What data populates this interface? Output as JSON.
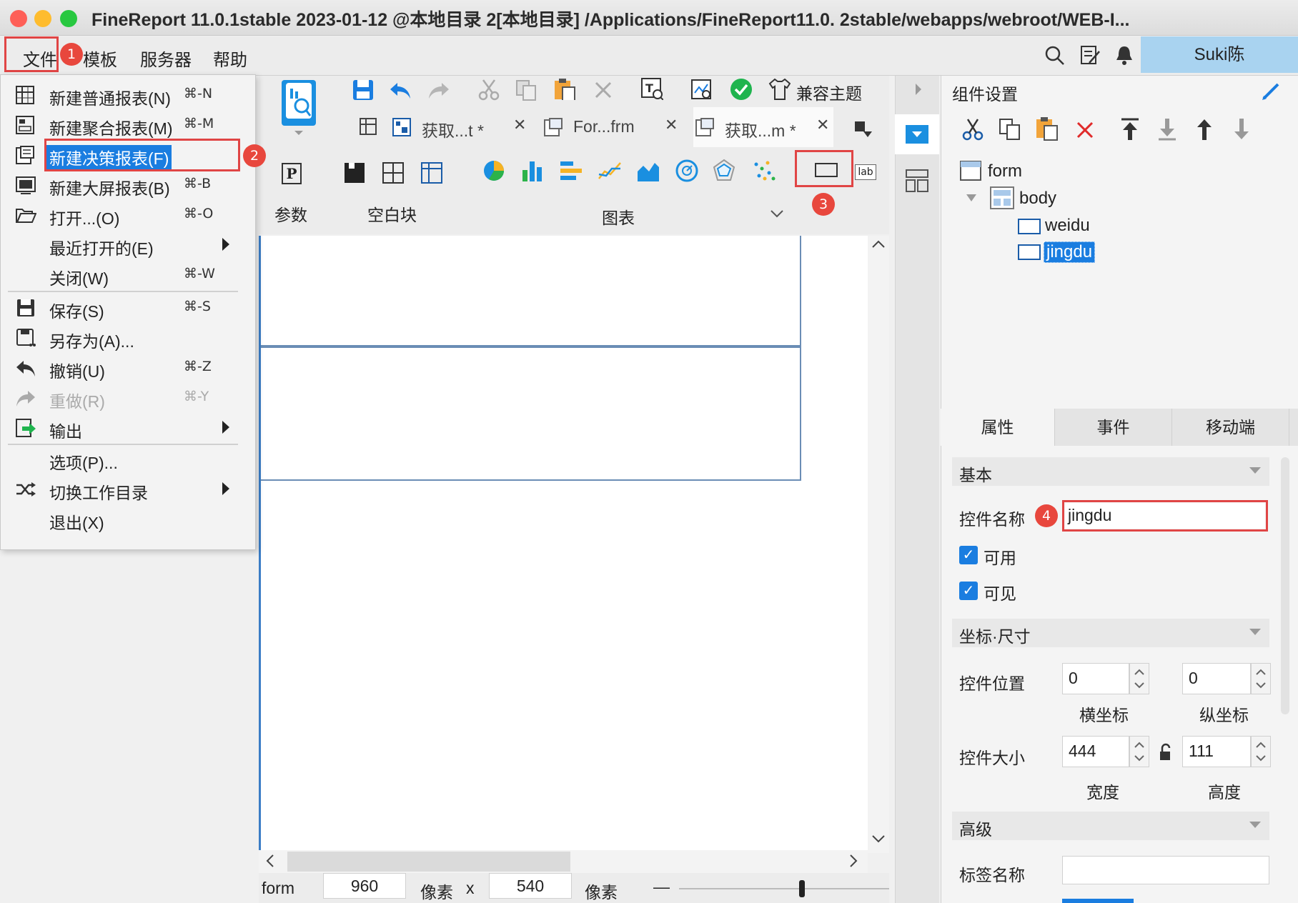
{
  "window": {
    "title": "FineReport 11.0.1stable 2023-01-12 @本地目录 2[本地目录]   /Applications/FineReport11.0. 2stable/webapps/webroot/WEB-I..."
  },
  "menubar": {
    "items": [
      "文件",
      "模板",
      "服务器",
      "帮助"
    ],
    "user": "Suki陈"
  },
  "badges": [
    "1",
    "2",
    "3",
    "4"
  ],
  "file_menu": {
    "items": [
      {
        "label": "新建普通报表(N)",
        "shortcut": "⌘-N"
      },
      {
        "label": "新建聚合报表(M)",
        "shortcut": "⌘-M"
      },
      {
        "label": "新建决策报表(F)",
        "shortcut": ""
      },
      {
        "label": "新建大屏报表(B)",
        "shortcut": "⌘-B"
      },
      {
        "label": "打开...(O)",
        "shortcut": "⌘-O"
      },
      {
        "label": "最近打开的(E)",
        "shortcut": ""
      },
      {
        "label": "关闭(W)",
        "shortcut": "⌘-W"
      },
      {
        "label": "保存(S)",
        "shortcut": "⌘-S"
      },
      {
        "label": "另存为(A)...",
        "shortcut": ""
      },
      {
        "label": "撤销(U)",
        "shortcut": "⌘-Z"
      },
      {
        "label": "重做(R)",
        "shortcut": "⌘-Y"
      },
      {
        "label": "输出",
        "shortcut": ""
      },
      {
        "label": "选项(P)...",
        "shortcut": ""
      },
      {
        "label": "切换工作目录",
        "shortcut": ""
      },
      {
        "label": "退出(X)",
        "shortcut": ""
      }
    ]
  },
  "toolbar": {
    "theme_label": "兼容主题",
    "tabs": [
      "获取...t *",
      "For...frm",
      "获取...m *"
    ],
    "groups": {
      "param": "参数",
      "blank": "空白块",
      "chart": "图表"
    },
    "label_widget": "lab"
  },
  "statusbar": {
    "form_label": "form",
    "width": "960",
    "unit1": "像素",
    "x": "x",
    "height": "540",
    "unit2": "像素",
    "zoom_minus": "—"
  },
  "right_panel": {
    "title": "组件设置",
    "tree": [
      "form",
      "body",
      "weidu",
      "jingdu"
    ],
    "tabs": [
      "属性",
      "事件",
      "移动端"
    ],
    "sections": {
      "basic": "基本",
      "coords": "坐标·尺寸",
      "advanced": "高级"
    },
    "widget_name_label": "控件名称",
    "widget_name_value": "jingdu",
    "enabled_label": "可用",
    "visible_label": "可见",
    "position_label": "控件位置",
    "x_value": "0",
    "y_value": "0",
    "x_caption": "横坐标",
    "y_caption": "纵坐标",
    "size_label": "控件大小",
    "width_value": "444",
    "height_value": "111",
    "width_caption": "宽度",
    "height_caption": "高度",
    "tag_name_label": "标签名称"
  }
}
